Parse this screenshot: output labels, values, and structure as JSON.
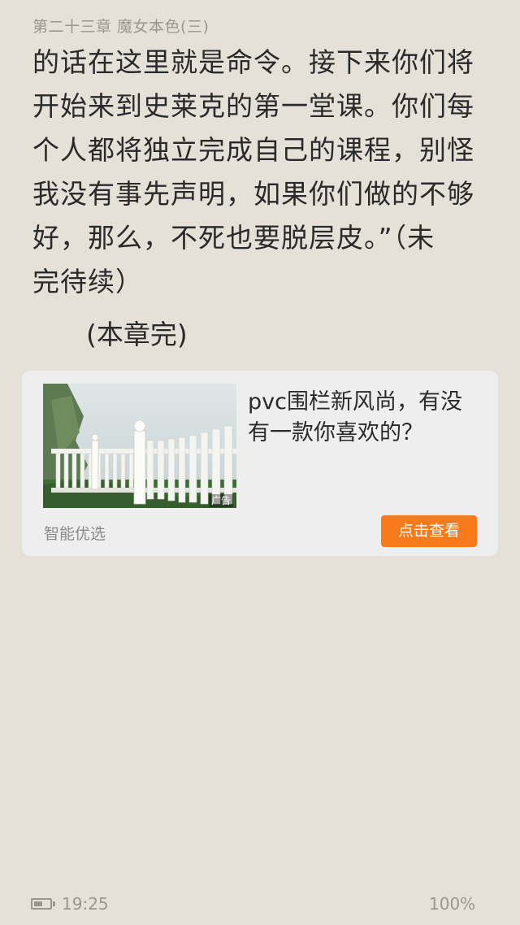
{
  "chapter": {
    "title": "第二十三章 魔女本色(三)"
  },
  "body": {
    "lines": [
      "的话在这里就是命令。接下来你们将",
      "开始来到史莱克的第一堂课。你们每",
      "个人都将独立完成自己的课程，别怪",
      "我没有事先声明，如果你们做的不够",
      "好，那么，不死也要脱层皮。”（未",
      "完待续）"
    ],
    "end_mark": "(本章完)"
  },
  "ad": {
    "image_icon": "pvc-fence-photo",
    "tag": "广告",
    "title": "pvc围栏新风尚，有没有一款你喜欢的？",
    "source": "智能优选",
    "cta_label": "点击查看",
    "cta_color": "#f77a1b"
  },
  "status": {
    "battery_icon": "battery-icon",
    "battery_level": 0.55,
    "time": "19:25",
    "progress": "100%"
  },
  "colors": {
    "background": "#e5e1d9",
    "card": "#eeeeee",
    "muted_text": "#9a9790"
  }
}
